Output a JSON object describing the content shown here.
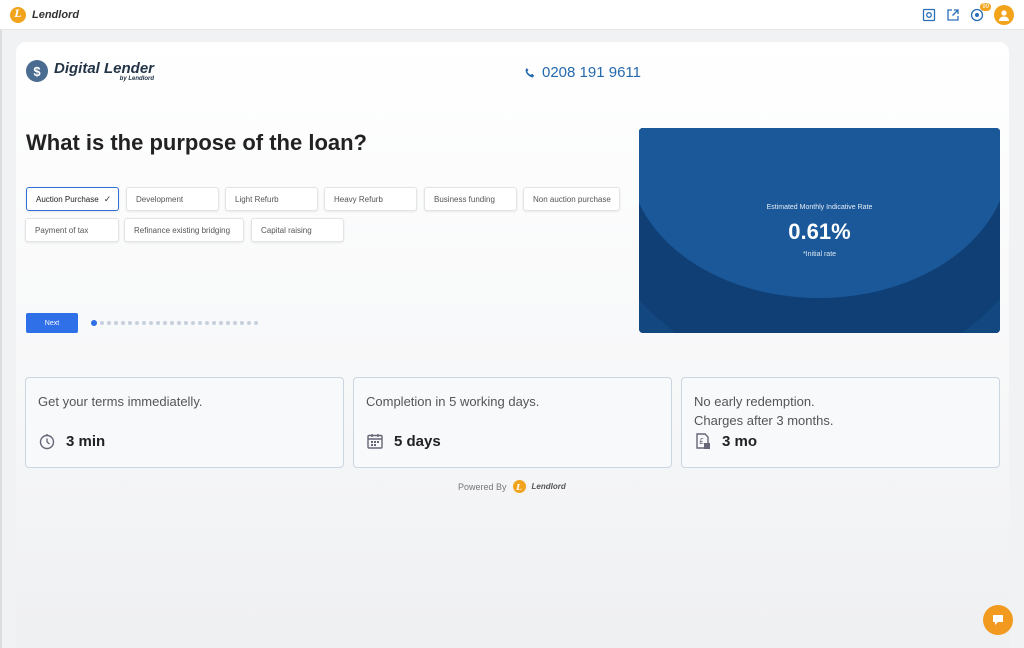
{
  "topbar": {
    "brand": "Lendlord",
    "brand_initial": "L",
    "notification_count": "99"
  },
  "logo": {
    "title": "Digital Lender",
    "subtitle": "by Lendlord",
    "mark": "$"
  },
  "contact": {
    "phone": "0208 191 9611"
  },
  "question": "What is the purpose of the loan?",
  "options": [
    {
      "label": "Auction Purchase",
      "selected": true
    },
    {
      "label": "Development"
    },
    {
      "label": "Light Refurb"
    },
    {
      "label": "Heavy Refurb"
    },
    {
      "label": "Business funding"
    },
    {
      "label": "Non auction purchase"
    },
    {
      "label": "Payment of tax"
    },
    {
      "label": "Refinance existing bridging"
    },
    {
      "label": "Capital raising"
    }
  ],
  "next_label": "Next",
  "progress": {
    "current_step": 1,
    "total_steps": 24
  },
  "rate": {
    "label": "Estimated Monthly Indicative Rate",
    "value": "0.61%",
    "note": "*Initial rate"
  },
  "features": [
    {
      "title": "Get your terms immediatelly.",
      "value": "3 min",
      "icon": "timer-icon"
    },
    {
      "title": "Completion in 5 working days.",
      "value": "5 days",
      "icon": "calendar-icon"
    },
    {
      "title": "No early redemption.",
      "title2": "Charges after 3 months.",
      "value": "3 mo",
      "icon": "pound-document-icon"
    }
  ],
  "footer": {
    "powered_by": "Powered By",
    "brand": "Lendlord",
    "brand_initial": "L"
  },
  "colors": {
    "accent": "#2f6fe8",
    "panel": "#13477f",
    "brand_orange": "#f2a31c"
  }
}
